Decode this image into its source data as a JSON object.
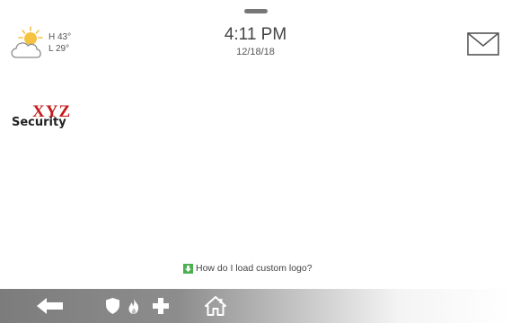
{
  "weather": {
    "icon": "partly-cloudy-icon",
    "high": "H 43°",
    "low": "L 29°"
  },
  "clock": {
    "time": "4:11 PM",
    "date": "12/18/18"
  },
  "logo": {
    "line1": "XYZ",
    "line2": "Security",
    "colors": {
      "line1": "#c51a1a",
      "line2": "#222222"
    }
  },
  "help": {
    "text": "How do I load custom logo?",
    "icon": "download-arrow-icon",
    "icon_color": "#4caf50"
  },
  "bottom_bar": {
    "buttons": [
      "back-arrow-icon",
      "shield-icon",
      "flame-icon",
      "medical-cross-icon",
      "home-icon"
    ]
  },
  "top": {
    "pull_handle": "pull-down-handle",
    "mail_icon": "envelope-icon"
  }
}
